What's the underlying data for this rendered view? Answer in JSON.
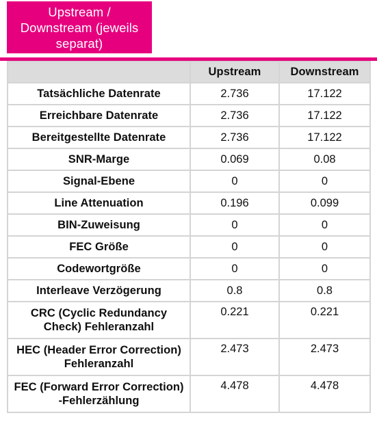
{
  "banner": {
    "title": "Upstream /\nDownstream (jeweils\nseparat)",
    "background_color": "#e6007e",
    "text_color": "#ffffff"
  },
  "accent_rule": {
    "color": "#e6007e"
  },
  "table": {
    "columns": [
      "",
      "Upstream",
      "Downstream"
    ],
    "header_background": "#dcdcdc",
    "border_color": "#d4d4d4",
    "rows": [
      {
        "label": "Tatsächliche Datenrate",
        "upstream": "2.736",
        "downstream": "17.122",
        "tall": false
      },
      {
        "label": "Erreichbare Datenrate",
        "upstream": "2.736",
        "downstream": "17.122",
        "tall": false
      },
      {
        "label": "Bereitgestellte Datenrate",
        "upstream": "2.736",
        "downstream": "17.122",
        "tall": false
      },
      {
        "label": "SNR-Marge",
        "upstream": "0.069",
        "downstream": "0.08",
        "tall": false
      },
      {
        "label": "Signal-Ebene",
        "upstream": "0",
        "downstream": "0",
        "tall": false
      },
      {
        "label": "Line Attenuation",
        "upstream": "0.196",
        "downstream": "0.099",
        "tall": false
      },
      {
        "label": "BIN-Zuweisung",
        "upstream": "0",
        "downstream": "0",
        "tall": false
      },
      {
        "label": "FEC Größe",
        "upstream": "0",
        "downstream": "0",
        "tall": false
      },
      {
        "label": "Codewortgröße",
        "upstream": "0",
        "downstream": "0",
        "tall": false
      },
      {
        "label": "Interleave Verzögerung",
        "upstream": "0.8",
        "downstream": "0.8",
        "tall": false
      },
      {
        "label": "CRC (Cyclic Redundancy Check) Fehleranzahl",
        "upstream": "0.221",
        "downstream": "0.221",
        "tall": true
      },
      {
        "label": "HEC (Header Error Correction) Fehleranzahl",
        "upstream": "2.473",
        "downstream": "2.473",
        "tall": true
      },
      {
        "label": "FEC (Forward Error Correction) -Fehlerzählung",
        "upstream": "4.478",
        "downstream": "4.478",
        "tall": true
      }
    ]
  }
}
